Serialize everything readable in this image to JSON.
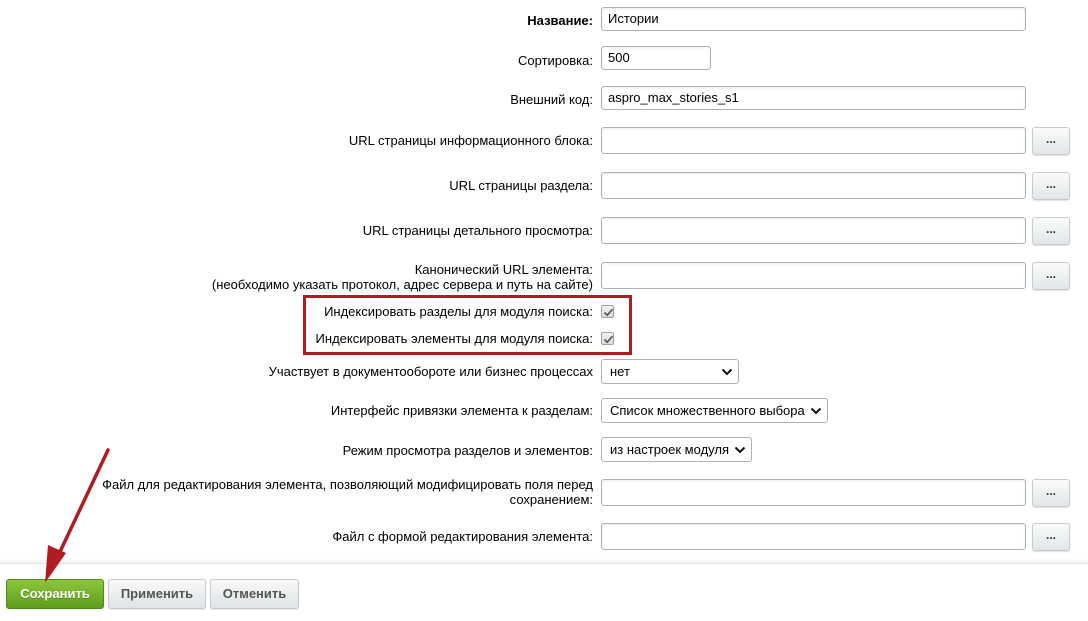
{
  "form": {
    "name_label": "Название:",
    "name_value": "Истории",
    "sort_label": "Сортировка:",
    "sort_value": "500",
    "code_label": "Внешний код:",
    "code_value": "aspro_max_stories_s1",
    "list_url_label": "URL страницы информационного блока:",
    "list_url_value": "",
    "section_url_label": "URL страницы раздела:",
    "section_url_value": "",
    "detail_url_label": "URL страницы детального просмотра:",
    "detail_url_value": "",
    "canonical_label_line1": "Канонический URL элемента:",
    "canonical_label_line2": "(необходимо указать протокол, адрес сервера и путь на сайте)",
    "canonical_value": "",
    "index_sections_label": "Индексировать разделы для модуля поиска:",
    "index_sections_checked": true,
    "index_elements_label": "Индексировать элементы для модуля поиска:",
    "index_elements_checked": true,
    "workflow_label": "Участвует в документообороте или бизнес процессах",
    "workflow_value": "нет",
    "section_binding_label": "Интерфейс привязки элемента к разделам:",
    "section_binding_value": "Список множественного выбора",
    "view_mode_label": "Режим просмотра разделов и элементов:",
    "view_mode_value": "из настроек модуля",
    "edit_file_label": "Файл для редактирования элемента, позволяющий модифицировать поля перед сохранением:",
    "edit_file_value": "",
    "edit_form_file_label": "Файл с формой редактирования элемента:",
    "edit_form_file_value": "",
    "dots_label": "..."
  },
  "footer": {
    "save_label": "Сохранить",
    "apply_label": "Применить",
    "cancel_label": "Отменить"
  },
  "colors": {
    "highlight": "#b01c22",
    "save_button": "#6fae27"
  }
}
